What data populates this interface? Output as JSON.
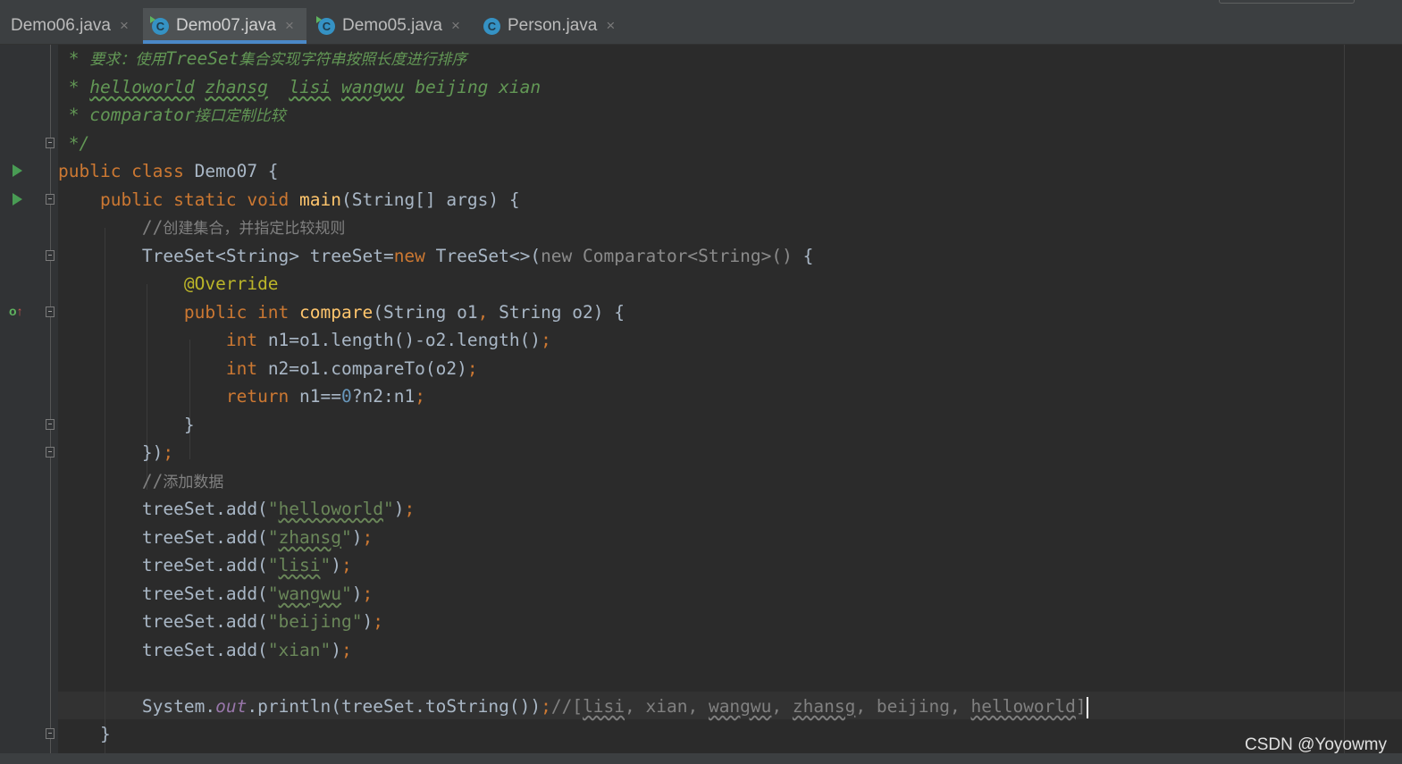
{
  "tabs": [
    {
      "label": "Demo06.java",
      "close": "×",
      "icon": "run-class-icon"
    },
    {
      "label": "Demo07.java",
      "close": "×",
      "icon": "run-class-icon"
    },
    {
      "label": "Demo05.java",
      "close": "×",
      "icon": "run-class-icon"
    },
    {
      "label": "Person.java",
      "close": "×",
      "icon": "class-icon"
    }
  ],
  "icon_letter": "C",
  "code": {
    "l1": {
      "a": " * ",
      "b": "要求：使用",
      "c": "TreeSet",
      "d": "集合实现字符串按照长度进行排序"
    },
    "l2": {
      "a": " * ",
      "w1": "helloworld",
      "s1": " ",
      "w2": "zhansg",
      "s2": "  ",
      "w3": "lisi",
      "s3": " ",
      "w4": "wangwu",
      "rest": " beijing xian"
    },
    "l3": {
      "a": " * comparator",
      "b": "接口定制比较"
    },
    "l4": {
      "a": " */"
    },
    "l5": {
      "kw": "public class ",
      "rest": "Demo07 {"
    },
    "l6": {
      "indent": "    ",
      "kw": "public static void ",
      "fn": "main",
      "rest": "(String[] args) {"
    },
    "l7": {
      "indent": "        ",
      "slash": "//",
      "text": "创建集合，并指定比较规则"
    },
    "l8": {
      "indent": "        ",
      "a": "TreeSet<String> treeSet=",
      "kw": "new ",
      "b": "TreeSet<>(",
      "c": "new Comparator<String>() ",
      "d": "{"
    },
    "l9": {
      "indent": "            ",
      "ann": "@Override"
    },
    "l10": {
      "indent": "            ",
      "kw": "public int ",
      "fn": "compare",
      "a": "(String o1",
      "comma": ", ",
      "b": "String o2) {"
    },
    "l11": {
      "indent": "                ",
      "kw": "int ",
      "a": "n1=o1.length()-o2.length()",
      "semi": ";"
    },
    "l12": {
      "indent": "                ",
      "kw": "int ",
      "a": "n2=o1.compareTo(o2)",
      "semi": ";"
    },
    "l13": {
      "indent": "                ",
      "kw": "return ",
      "a": "n1==",
      "num": "0",
      "b": "?n2:n1",
      "semi": ";"
    },
    "l14": {
      "indent": "            ",
      "a": "}"
    },
    "l15": {
      "indent": "        ",
      "a": "})",
      "semi": ";"
    },
    "l16": {
      "indent": "        ",
      "slash": "//",
      "text": "添加数据"
    },
    "l17": {
      "indent": "        ",
      "a": "treeSet.add(",
      "q1": "\"",
      "s": "helloworld",
      "q2": "\"",
      "b": ")",
      "semi": ";"
    },
    "l18": {
      "indent": "        ",
      "a": "treeSet.add(",
      "q1": "\"",
      "s": "zhansg",
      "q2": "\"",
      "b": ")",
      "semi": ";"
    },
    "l19": {
      "indent": "        ",
      "a": "treeSet.add(",
      "q1": "\"",
      "s": "lisi",
      "q2": "\"",
      "b": ")",
      "semi": ";"
    },
    "l20": {
      "indent": "        ",
      "a": "treeSet.add(",
      "q1": "\"",
      "s": "wangwu",
      "q2": "\"",
      "b": ")",
      "semi": ";"
    },
    "l21": {
      "indent": "        ",
      "a": "treeSet.add(",
      "s": "\"beijing\"",
      "b": ")",
      "semi": ";"
    },
    "l22": {
      "indent": "        ",
      "a": "treeSet.add(",
      "s": "\"xian\"",
      "b": ")",
      "semi": ";"
    },
    "l24": {
      "indent": "        ",
      "a": "System.",
      "fld": "out",
      "b": ".println(treeSet.toString())",
      "semi": ";",
      "c1": "//[",
      "w1": "lisi",
      "c2": ", xian, ",
      "w2": "wangwu",
      "c3": ", ",
      "w3": "zhansg",
      "c4": ", beijing, ",
      "w4": "helloworld",
      "c5": "]"
    },
    "l25": {
      "indent": "    ",
      "a": "}"
    }
  },
  "gutter": {
    "override_icon": "o",
    "override_arrow": "↑"
  },
  "watermark": "CSDN @Yoyowmy",
  "colors": {
    "background": "#2b2b2b",
    "keyword": "#cc7832",
    "string": "#6a8759",
    "javadoc": "#629755",
    "comment": "#808080",
    "function": "#ffc66d",
    "annotation": "#bbb529",
    "number": "#6897bb",
    "tab_accent": "#4a88c7"
  }
}
